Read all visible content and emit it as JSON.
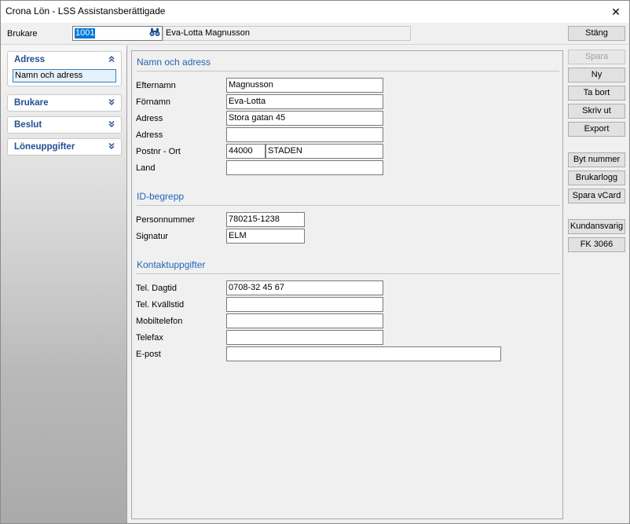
{
  "window": {
    "title": "Crona Lön - LSS Assistansberättigade",
    "close_glyph": "✕"
  },
  "toolbar": {
    "brukare_label": "Brukare",
    "code_value": "1001",
    "name_value": "Eva-Lotta Magnusson",
    "stang_label": "Stäng"
  },
  "sidebar": {
    "groups": [
      {
        "label": "Adress",
        "items": [
          "Namn och adress"
        ]
      },
      {
        "label": "Brukare"
      },
      {
        "label": "Beslut"
      },
      {
        "label": "Löneuppgifter"
      }
    ]
  },
  "sections": {
    "namn": {
      "title": "Namn och adress",
      "efternamn_label": "Efternamn",
      "efternamn": "Magnusson",
      "fornamn_label": "Förnamn",
      "fornamn": "Eva-Lotta",
      "adress1_label": "Adress",
      "adress1": "Stora gatan 45",
      "adress2_label": "Adress",
      "adress2": "",
      "postnr_label": "Postnr - Ort",
      "postnr": "44000",
      "ort": "STADEN",
      "land_label": "Land",
      "land": ""
    },
    "id": {
      "title": "ID-begrepp",
      "personnummer_label": "Personnummer",
      "personnummer": "780215-1238",
      "signatur_label": "Signatur",
      "signatur": "ELM"
    },
    "kontakt": {
      "title": "Kontaktuppgifter",
      "dagtid_label": "Tel. Dagtid",
      "dagtid": "0708-32 45 67",
      "kvallstid_label": "Tel. Kvällstid",
      "kvallstid": "",
      "mobil_label": "Mobiltelefon",
      "mobil": "",
      "telefax_label": "Telefax",
      "telefax": "",
      "epost_label": "E-post",
      "epost": ""
    }
  },
  "actions": {
    "spara": "Spara",
    "ny": "Ny",
    "ta_bort": "Ta bort",
    "skriv_ut": "Skriv ut",
    "export": "Export",
    "byt_nummer": "Byt nummer",
    "brukarlogg": "Brukarlogg",
    "spara_vcard": "Spara vCard",
    "kundansvarig": "Kundansvarig",
    "fk3066": "FK 3066"
  }
}
